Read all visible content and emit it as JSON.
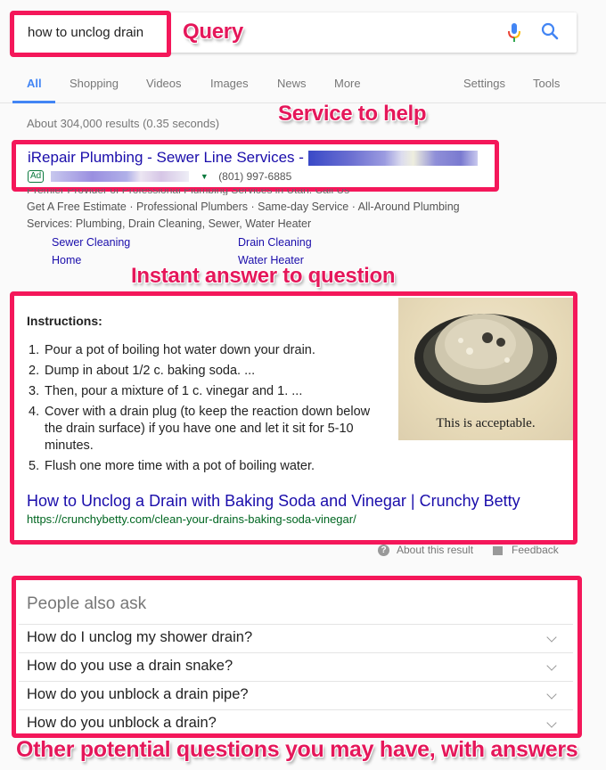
{
  "search": {
    "query": "how to unclog drain",
    "mic_icon": "microphone-icon",
    "search_icon": "magnifier-icon"
  },
  "tabs": [
    {
      "label": "All",
      "active": true
    },
    {
      "label": "Shopping"
    },
    {
      "label": "Videos"
    },
    {
      "label": "Images"
    },
    {
      "label": "News"
    },
    {
      "label": "More"
    },
    {
      "label": "Settings"
    },
    {
      "label": "Tools"
    }
  ],
  "stats": "About 304,000 results (0.35 seconds)",
  "annotations": {
    "query": "Query",
    "service": "Service to help",
    "instant": "Instant answer to question",
    "other": "Other potential questions you may have, with answers"
  },
  "ad": {
    "title": "iRepair Plumbing - Sewer Line Services -",
    "badge": "Ad",
    "phone": "(801) 997-6885",
    "desc_cut": "Premier Provider of Professional Plumbing Services in Utah. Call Us",
    "desc_line1": "Get A Free Estimate · Professional Plumbers · Same-day Service · All-Around Plumbing",
    "desc_line2": "Services: Plumbing, Drain Cleaning, Sewer, Water Heater",
    "sitelinks": [
      "Sewer Cleaning",
      "Drain Cleaning",
      "Home",
      "Water Heater"
    ]
  },
  "snippet": {
    "heading": "Instructions:",
    "steps": [
      "Pour a pot of boiling hot water down your drain.",
      "Dump in about 1/2 c. baking soda. ...",
      "Then, pour a mixture of 1 c. vinegar and 1. ...",
      "Cover with a drain plug (to keep the reaction down below the drain surface) if you have one and let it sit for 5-10 minutes.",
      "Flush one more time with a pot of boiling water."
    ],
    "image_caption": "This is acceptable.",
    "link_title": "How to Unclog a Drain with Baking Soda and Vinegar | Crunchy Betty",
    "link_url": "https://crunchybetty.com/clean-your-drains-baking-soda-vinegar/",
    "about_label": "About this result",
    "feedback_label": "Feedback"
  },
  "paa": {
    "heading": "People also ask",
    "questions": [
      "How do I unclog my shower drain?",
      "How do you use a drain snake?",
      "How do you unblock a drain pipe?",
      "How do you unblock a drain?"
    ]
  },
  "colors": {
    "annotation": "#f4175a",
    "link": "#1a0dab",
    "url": "#006621",
    "tab_active": "#4285f4"
  }
}
